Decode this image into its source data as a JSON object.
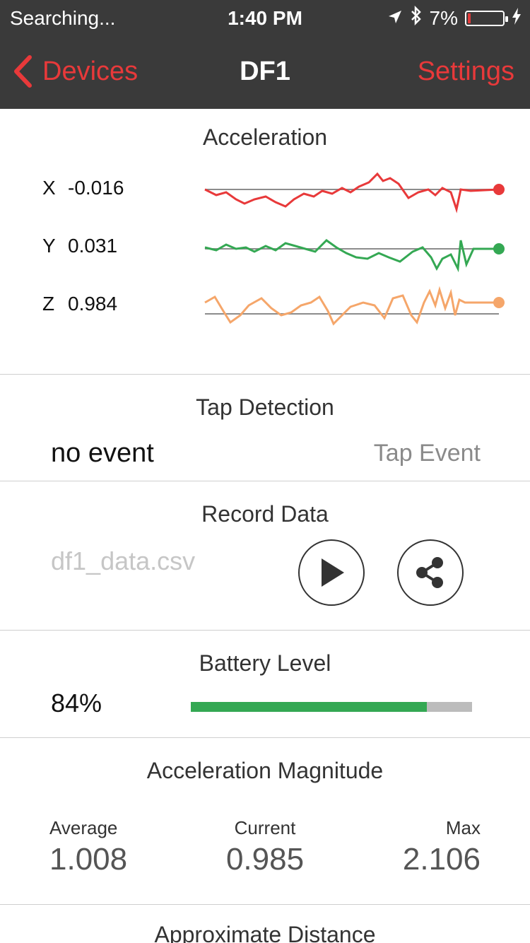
{
  "status_bar": {
    "carrier": "Searching...",
    "time": "1:40 PM",
    "battery_percent": "7%"
  },
  "nav": {
    "back_label": "Devices",
    "title": "DF1",
    "settings_label": "Settings"
  },
  "acceleration": {
    "title": "Acceleration",
    "axes": [
      {
        "label": "X",
        "value": "-0.016",
        "color": "#e8393a"
      },
      {
        "label": "Y",
        "value": "0.031",
        "color": "#34a853"
      },
      {
        "label": "Z",
        "value": "0.984",
        "color": "#f5a66a"
      }
    ]
  },
  "tap_detection": {
    "title": "Tap Detection",
    "status": "no event",
    "event_label": "Tap Event"
  },
  "record_data": {
    "title": "Record Data",
    "filename": "df1_data.csv"
  },
  "battery_level": {
    "title": "Battery Level",
    "percent_label": "84%",
    "percent": 0.84
  },
  "magnitude": {
    "title": "Acceleration Magnitude",
    "average_label": "Average",
    "average_value": "1.008",
    "current_label": "Current",
    "current_value": "0.985",
    "max_label": "Max",
    "max_value": "2.106"
  },
  "distance": {
    "title": "Approximate Distance"
  },
  "colors": {
    "accent_red": "#e8393a",
    "green": "#34a853",
    "orange": "#f5a66a",
    "header_bg": "#3a3a3a"
  }
}
